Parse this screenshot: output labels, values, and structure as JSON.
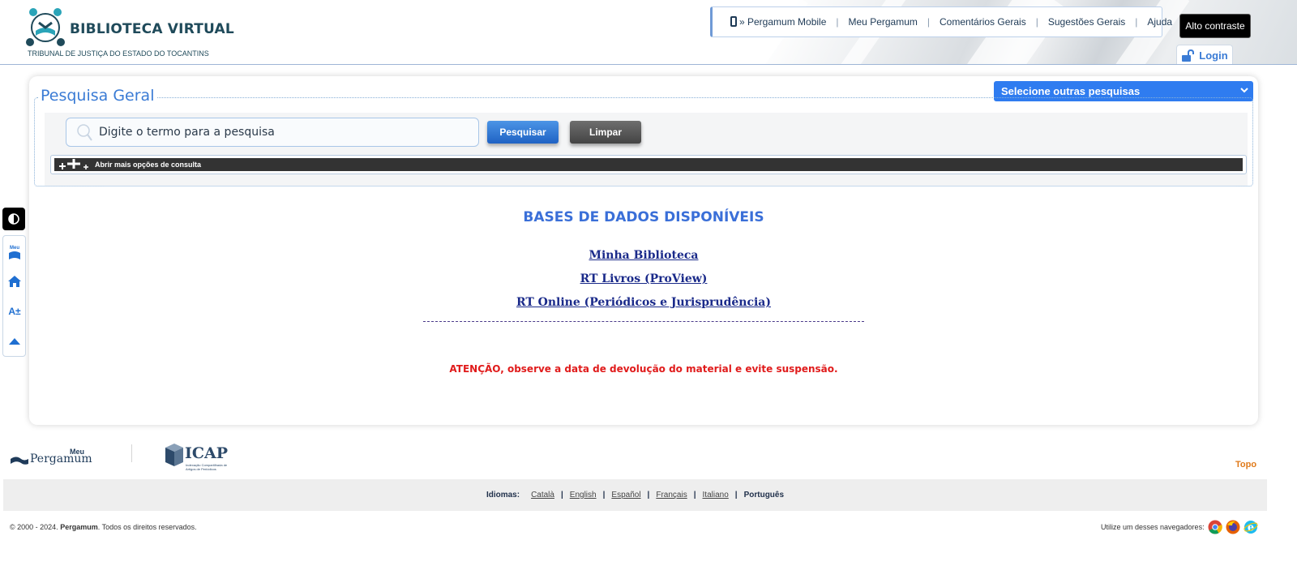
{
  "header": {
    "logo_title": "BIBLIOTECA VIRTUAL",
    "logo_subtitle": "TRIBUNAL DE JUSTIÇA DO ESTADO DO TOCANTINS",
    "nav": [
      {
        "label": "» Pergamum Mobile",
        "icon": "phone-icon"
      },
      {
        "label": "Meu Pergamum"
      },
      {
        "label": "Comentários Gerais"
      },
      {
        "label": "Sugestões Gerais"
      },
      {
        "label": "Ajuda"
      }
    ],
    "nav_separator": "|",
    "contrast_label": "Alto contraste",
    "login_label": "Login"
  },
  "search": {
    "legend": "Pesquisa Geral",
    "placeholder": "Digite o termo para a pesquisa",
    "search_button": "Pesquisar",
    "clear_button": "Limpar",
    "more_options": "Abrir mais opções de consulta",
    "other_searches": "Selecione outras pesquisas"
  },
  "bases": {
    "title": "BASES DE DADOS DISPONÍVEIS",
    "links": [
      "Minha Biblioteca",
      "RT Livros (ProView)",
      "RT Online (Periódicos e Jurisprudência)"
    ],
    "attention": "ATENÇÃO, observe a data de devolução do material e evite suspensão."
  },
  "sidebar": {
    "meu_label": "Meu",
    "font_label": "A±"
  },
  "footer": {
    "meu_pergamum_small": "Meu",
    "meu_pergamum_big": "Pergamum",
    "icap_text": "ICAP",
    "icap_subtitle": "Indexação Compartilhada de Artigos de Periódicos",
    "topo": "Topo",
    "languages_label": "Idiomas:",
    "languages": [
      "Català",
      "English",
      "Español",
      "Français",
      "Italiano"
    ],
    "current_language": "Português",
    "copyright_prefix": "© 2000 - 2024.",
    "copyright_brand": "Pergamum",
    "copyright_suffix": ". Todos os direitos reservados.",
    "browsers_label": "Utilize um desses navegadores:"
  },
  "colors": {
    "accent": "#3a7bd5",
    "attention": "#e01b1b",
    "link": "#1a2a8a",
    "topo": "#e07a1a"
  }
}
